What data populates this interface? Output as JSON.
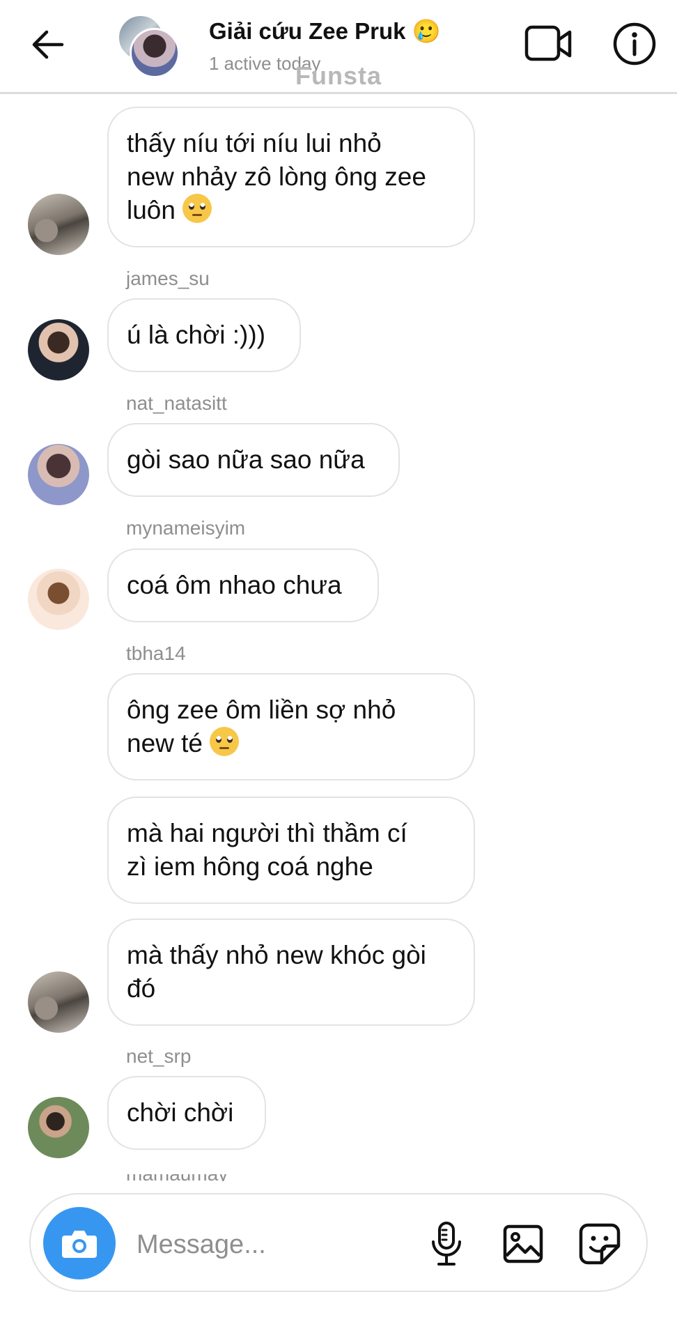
{
  "header": {
    "title": "Giải cứu Zee Pruk 🥲",
    "subtitle": "1 active today",
    "watermark": "Funsta",
    "back_icon": "back-arrow-icon",
    "video_icon": "video-call-icon",
    "info_icon": "info-icon"
  },
  "messages": [
    {
      "username": "",
      "lines": [
        "thấy níu tới níu lui nhỏ",
        "new nhảy zô lòng ông zee",
        "luôn"
      ],
      "emoji": "🙄"
    },
    {
      "username": "james_su",
      "lines": [
        "ú là chời :)))"
      ]
    },
    {
      "username": "nat_natasitt",
      "lines": [
        "gòi sao nữa sao nữa"
      ]
    },
    {
      "username": "mynameisyim",
      "lines": [
        "coá ôm nhao chưa"
      ]
    },
    {
      "username": "tbha14",
      "lines": [
        "ông zee ôm liền sợ nhỏ",
        "new té"
      ],
      "emoji": "🙄"
    },
    {
      "username": "",
      "lines": [
        "mà hai người thì thầm cí",
        "zì iem hông coá nghe"
      ]
    },
    {
      "username": "",
      "lines": [
        "mà thấy nhỏ new khóc gòi",
        "đó"
      ]
    },
    {
      "username": "net_srp",
      "lines": [
        "chời chời"
      ]
    }
  ],
  "cut_username": "mamaumay",
  "composer": {
    "placeholder": "Message...",
    "camera_icon": "camera-icon",
    "mic_icon": "microphone-icon",
    "gallery_icon": "gallery-icon",
    "sticker_icon": "sticker-icon"
  },
  "colors": {
    "accent": "#3797f0",
    "secondary_text": "#8e8e8e",
    "bubble_border": "#e3e3e3"
  }
}
